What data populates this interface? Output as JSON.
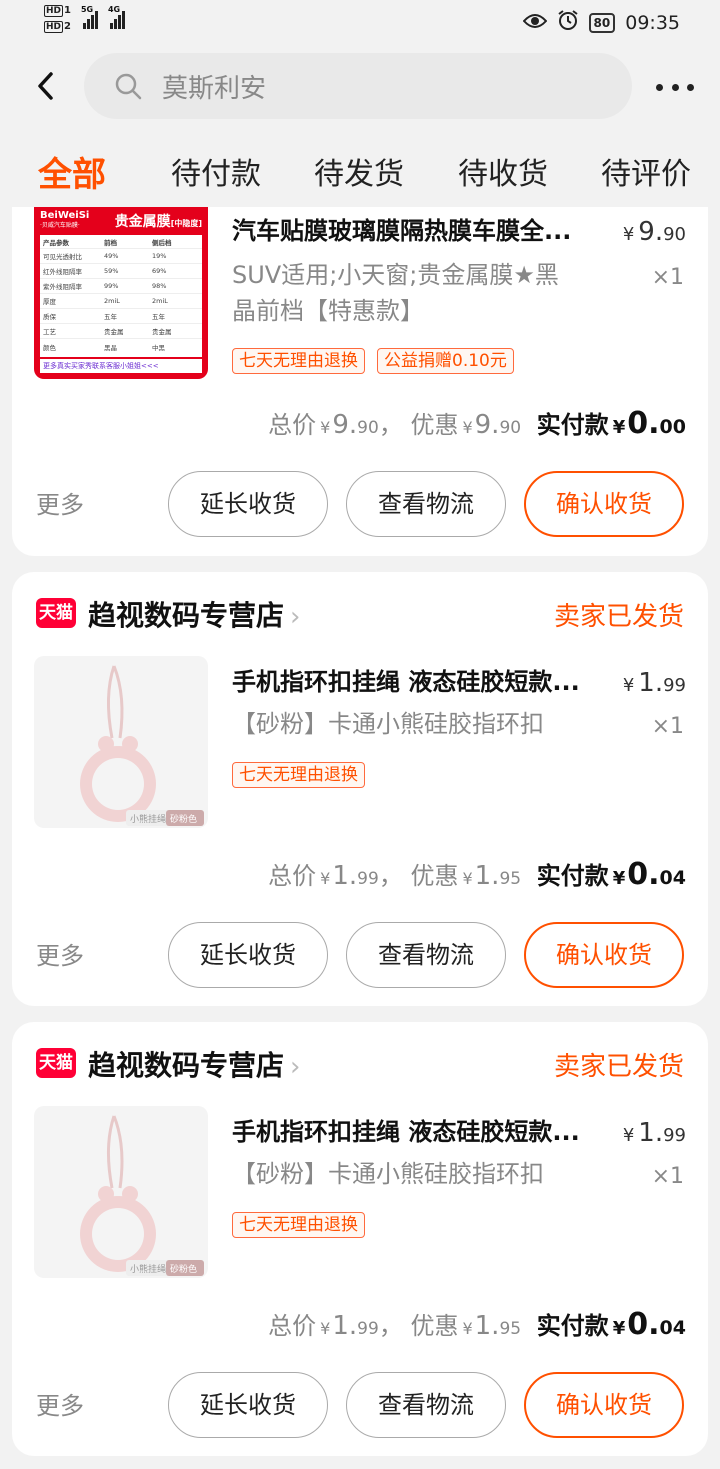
{
  "status_bar": {
    "sim1": "HD",
    "sim1_num": "1",
    "sim2": "HD",
    "sim2_num": "2",
    "net1": "5G",
    "net2": "4G",
    "battery": "80",
    "time": "09:35"
  },
  "header": {
    "search_placeholder": "莫斯利安"
  },
  "tabs": [
    {
      "label": "全部",
      "active": true
    },
    {
      "label": "待付款"
    },
    {
      "label": "待发货"
    },
    {
      "label": "待收货"
    },
    {
      "label": "待评价"
    }
  ],
  "orders": [
    {
      "title": "汽车贴膜玻璃膜隔热膜车膜全...",
      "price_int": "9.",
      "price_dec": "90",
      "sku_line1": "SUV适用;小天窗;贵金属膜★黑",
      "sku_line2": "晶前档【特惠款】",
      "qty": "×1",
      "tags": [
        "七天无理由退换",
        "公益捐赠0.10元"
      ],
      "total_label": "总价",
      "total_int": "9.",
      "total_dec": "90",
      "discount_label": "优惠",
      "discount_int": "9.",
      "discount_dec": "90",
      "paid_label": "实付款",
      "paid_int": "0.",
      "paid_dec": "00",
      "thumb": {
        "brand": "BeiWeiSi",
        "brand_sub": "·贝威汽车贴膜·",
        "product": "贵金属膜",
        "product_tag": "[中隐度]",
        "table_header": [
          "产品参数",
          "前档",
          "侧后档"
        ],
        "table_rows": [
          [
            "可见光透射比",
            "49%",
            "19%"
          ],
          [
            "红外线阻隔率",
            "59%",
            "69%"
          ],
          [
            "紫外线阻隔率",
            "99%",
            "98%"
          ],
          [
            "厚度",
            "2miL",
            "2miL"
          ],
          [
            "质保",
            "五年",
            "五年"
          ],
          [
            "工艺",
            "贵金属",
            "贵金属"
          ],
          [
            "颜色",
            "黑晶",
            "中黑"
          ]
        ],
        "footer": "更多真实买家秀联系客服小姐姐<<<"
      }
    },
    {
      "shop_badge": "天猫",
      "shop": "趋视数码专营店",
      "status": "卖家已发货",
      "title": "手机指环扣挂绳 液态硅胶短款...",
      "price_int": "1.",
      "price_dec": "99",
      "sku_line1": "【砂粉】卡通小熊硅胶指环扣",
      "qty": "×1",
      "tags": [
        "七天无理由退换"
      ],
      "total_label": "总价",
      "total_int": "1.",
      "total_dec": "99",
      "discount_label": "优惠",
      "discount_int": "1.",
      "discount_dec": "95",
      "paid_label": "实付款",
      "paid_int": "0.",
      "paid_dec": "04",
      "thumb_caption1": "小熊挂绳",
      "thumb_caption2": "砂粉色"
    },
    {
      "shop_badge": "天猫",
      "shop": "趋视数码专营店",
      "status": "卖家已发货",
      "title": "手机指环扣挂绳 液态硅胶短款...",
      "price_int": "1.",
      "price_dec": "99",
      "sku_line1": "【砂粉】卡通小熊硅胶指环扣",
      "qty": "×1",
      "tags": [
        "七天无理由退换"
      ],
      "total_label": "总价",
      "total_int": "1.",
      "total_dec": "99",
      "discount_label": "优惠",
      "discount_int": "1.",
      "discount_dec": "95",
      "paid_label": "实付款",
      "paid_int": "0.",
      "paid_dec": "04",
      "thumb_caption1": "小熊挂绳",
      "thumb_caption2": "砂粉色"
    }
  ],
  "actions": {
    "more": "更多",
    "extend": "延长收货",
    "logistics": "查看物流",
    "confirm": "确认收货"
  },
  "currency": "¥",
  "colors": {
    "accent": "#ff5000",
    "tmall": "#ff0036",
    "background": "#f2f2f2"
  }
}
